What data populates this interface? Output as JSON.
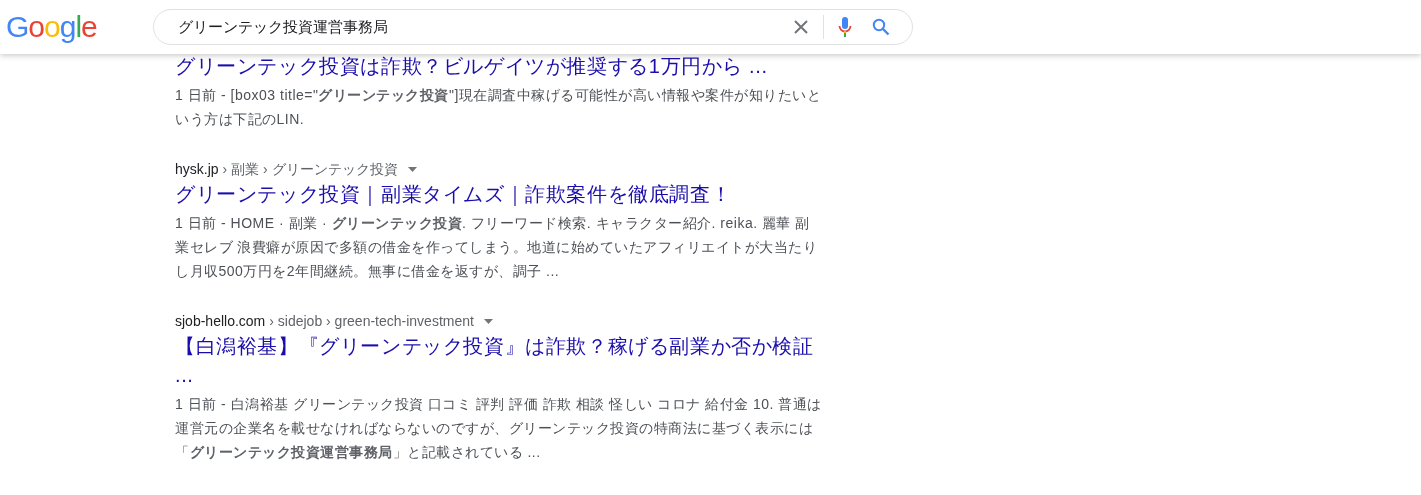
{
  "header": {
    "logo": "Google",
    "search": {
      "value": "グリーンテック投資運営事務局"
    }
  },
  "results": [
    {
      "title": "グリーンテック投資は詐欺？ビルゲイツが推奨する1万円から ...",
      "snippet": "1 日前 - [box03 title=\"**グリーンテック投資**\"]現在調査中稼げる可能性が高い情報や案件が知りたいという方は下記のLIN."
    },
    {
      "breadcrumb": {
        "site": "hysk.jp",
        "path": "› 副業 › グリーンテック投資"
      },
      "title": "グリーンテック投資｜副業タイムズ｜詐欺案件を徹底調査！",
      "snippet": "1 日前 - HOME · 副業 · **グリーンテック投資**. フリーワード検索. キャラクター紹介. reika. 麗華 副業セレブ 浪費癖が原因で多額の借金を作ってしまう。地道に始めていたアフィリエイトが大当たりし月収500万円を2年間継続。無事に借金を返すが、調子 ..."
    },
    {
      "breadcrumb": {
        "site": "sjob-hello.com",
        "path": "› sidejob › green-tech-investment"
      },
      "title": "【白潟裕基】『グリーンテック投資』は詐欺？稼げる副業か否か検証 ...",
      "snippet": "1 日前 - 白潟裕基 グリーンテック投資 口コミ 評判 評価 詐欺 相談 怪しい コロナ 給付金 10. 普通は運営元の企業名を載せなければならないのですが、グリーンテック投資の特商法に基づく表示には「**グリーンテック投資運営事務局**」と記載されている ..."
    }
  ]
}
